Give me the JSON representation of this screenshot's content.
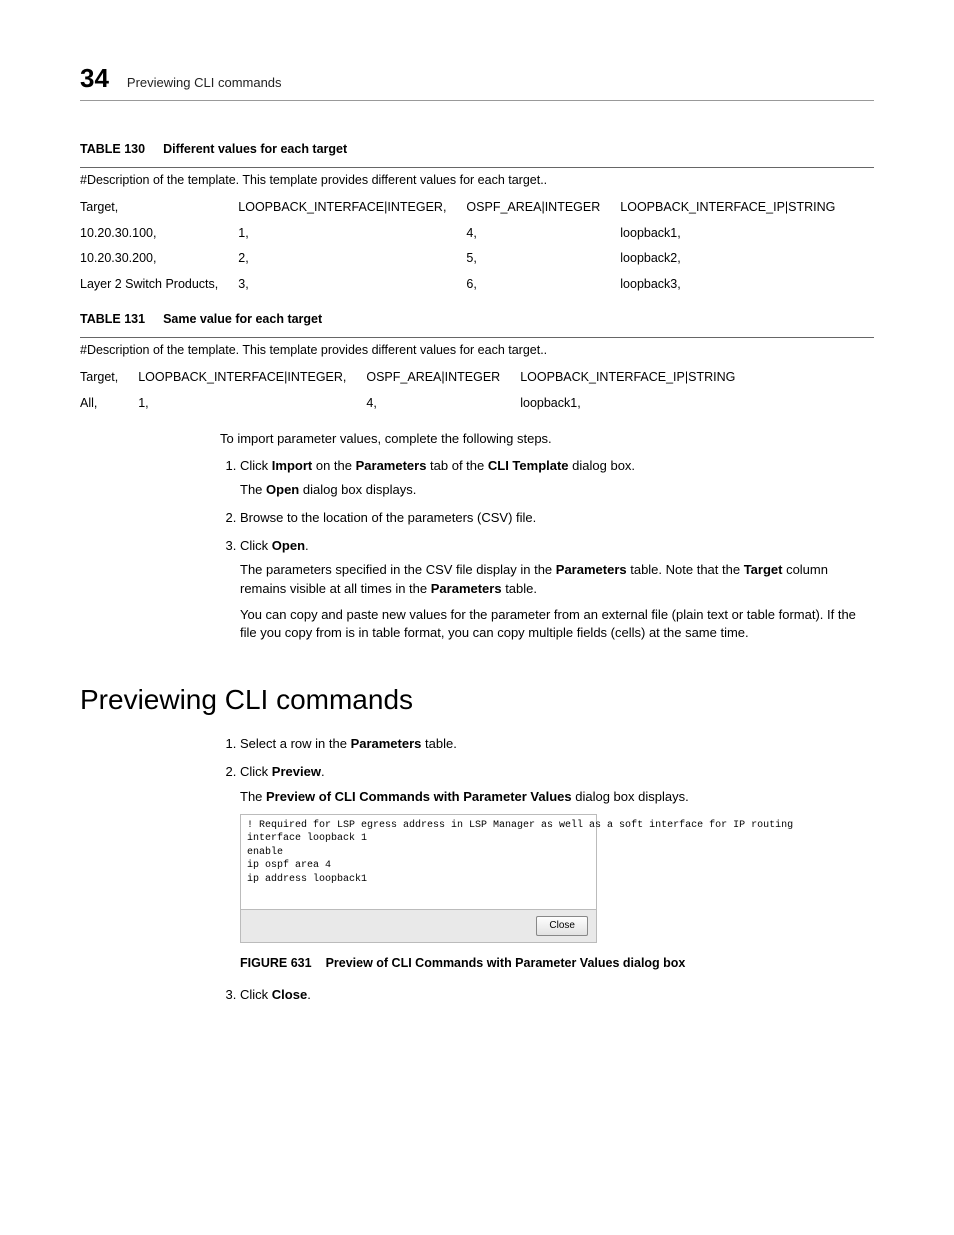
{
  "header": {
    "chapter": "34",
    "title": "Previewing CLI commands"
  },
  "table130": {
    "caption_label": "TABLE 130",
    "caption_text": "Different values for each target",
    "desc": "#Description of the template. This template provides different values for each target..",
    "head": [
      "Target,",
      "LOOPBACK_INTERFACE|INTEGER,",
      "OSPF_AREA|INTEGER",
      "LOOPBACK_INTERFACE_IP|STRING"
    ],
    "rows": [
      [
        "10.20.30.100,",
        "1,",
        "4,",
        "loopback1,"
      ],
      [
        "10.20.30.200,",
        "2,",
        "5,",
        "loopback2,"
      ],
      [
        "Layer 2 Switch Products,",
        "3,",
        "6,",
        "loopback3,"
      ]
    ]
  },
  "table131": {
    "caption_label": "TABLE 131",
    "caption_text": "Same value for each target",
    "desc": "#Description of the template. This template provides different values for each target..",
    "head": [
      "Target,",
      "LOOPBACK_INTERFACE|INTEGER,",
      "OSPF_AREA|INTEGER",
      "LOOPBACK_INTERFACE_IP|STRING"
    ],
    "rows": [
      [
        "All,",
        "1,",
        "4,",
        "loopback1,"
      ]
    ]
  },
  "import_intro": "To import parameter values, complete the following steps.",
  "import_steps": {
    "s1_a": "Click ",
    "s1_b": "Import",
    "s1_c": " on the ",
    "s1_d": "Parameters",
    "s1_e": " tab of the ",
    "s1_f": "CLI Template",
    "s1_g": " dialog box.",
    "s1_sub_a": "The ",
    "s1_sub_b": "Open",
    "s1_sub_c": " dialog box displays.",
    "s2": "Browse to the location of the parameters (CSV) file.",
    "s3_a": "Click ",
    "s3_b": "Open",
    "s3_c": ".",
    "s3_sub1_a": "The parameters specified in the CSV file display in the ",
    "s3_sub1_b": "Parameters",
    "s3_sub1_c": " table. Note that the ",
    "s3_sub1_d": "Target",
    "s3_sub1_e": " column remains visible at all times in the ",
    "s3_sub1_f": "Parameters",
    "s3_sub1_g": " table.",
    "s3_sub2": "You can copy and paste new values for the parameter from an external file (plain text or table format). If the file you copy from is in table format, you can copy multiple fields (cells) at the same time."
  },
  "section2": {
    "heading": "Previewing CLI commands",
    "s1_a": "Select a row in the ",
    "s1_b": "Parameters",
    "s1_c": " table.",
    "s2_a": "Click ",
    "s2_b": "Preview",
    "s2_c": ".",
    "s2_sub_a": "The ",
    "s2_sub_b": "Preview of CLI Commands with Parameter Values",
    "s2_sub_c": " dialog box displays.",
    "fig": {
      "line1": "! Required for LSP egress address in LSP Manager as well as a soft interface for IP routing",
      "line2": "interface loopback  1",
      "line3": "enable",
      "line4": "ip ospf area  4",
      "line5": "ip address   loopback1",
      "close": "Close"
    },
    "fig_caption_label": "FIGURE 631",
    "fig_caption_text": "Preview of CLI Commands with Parameter Values dialog box",
    "s3_a": "Click ",
    "s3_b": "Close",
    "s3_c": "."
  }
}
